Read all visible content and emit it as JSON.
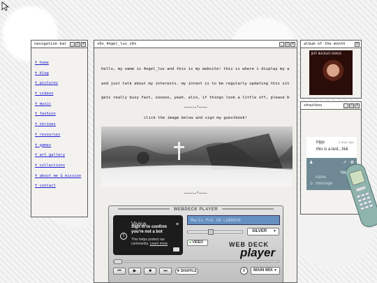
{
  "nav": {
    "title": "navigation bar",
    "items": [
      "home",
      "blog",
      "pictures",
      "videos",
      "music",
      "fashion",
      "shrines",
      "resources",
      "games",
      "art gallery",
      "collections",
      "about me & mission",
      "contact"
    ]
  },
  "window_buttons": {
    "minimize": "_",
    "maximize": "□",
    "close": "x"
  },
  "main": {
    "title": "x0x_4ngel_luv_x0x",
    "intro_lines": [
      "hello, my name is 4ngel_luv and this is my website! this is where i display my art, videos, pictures,",
      "and just talk about my interests. my intent is to be regularly updating this site but my schedule",
      "gets really busy fast, sooooo, yeah. also, if things look a little off, please be patient, i am still"
    ],
    "divider": "────✧˖°────",
    "guestbook_text": "click the image below and sign my guestbook!"
  },
  "album": {
    "title": "album of the month",
    "art_label": "JEFF BUCKLEY\nGRACE"
  },
  "shoutbox": {
    "title": "shoutbox",
    "message": {
      "name": "tripp",
      "time": "3 days ago",
      "text": "this is a test...hiiii"
    },
    "upgrade": "Upgrade",
    "name_placeholder": "name",
    "message_placeholder": "message"
  },
  "player": {
    "header": "WEBDECK PLAYER",
    "video": {
      "channel": "Vivica",
      "signin": "Sign in to confirm you're not a bot",
      "protect": "This helps protect our community.",
      "learn_more": "Learn more"
    },
    "screen_text": "Mario PoS IN LUBHOVE",
    "skin": "SILVER",
    "video_button": "VIDEO",
    "brand_top": "WEB DECK",
    "brand_bottom": "player",
    "controls": {
      "prev": "⏮",
      "play": "▶",
      "stop": "■",
      "next": "⏭"
    },
    "shuffle": "SHUFFLE",
    "info": "i",
    "playlist": "MAIN MIX"
  }
}
